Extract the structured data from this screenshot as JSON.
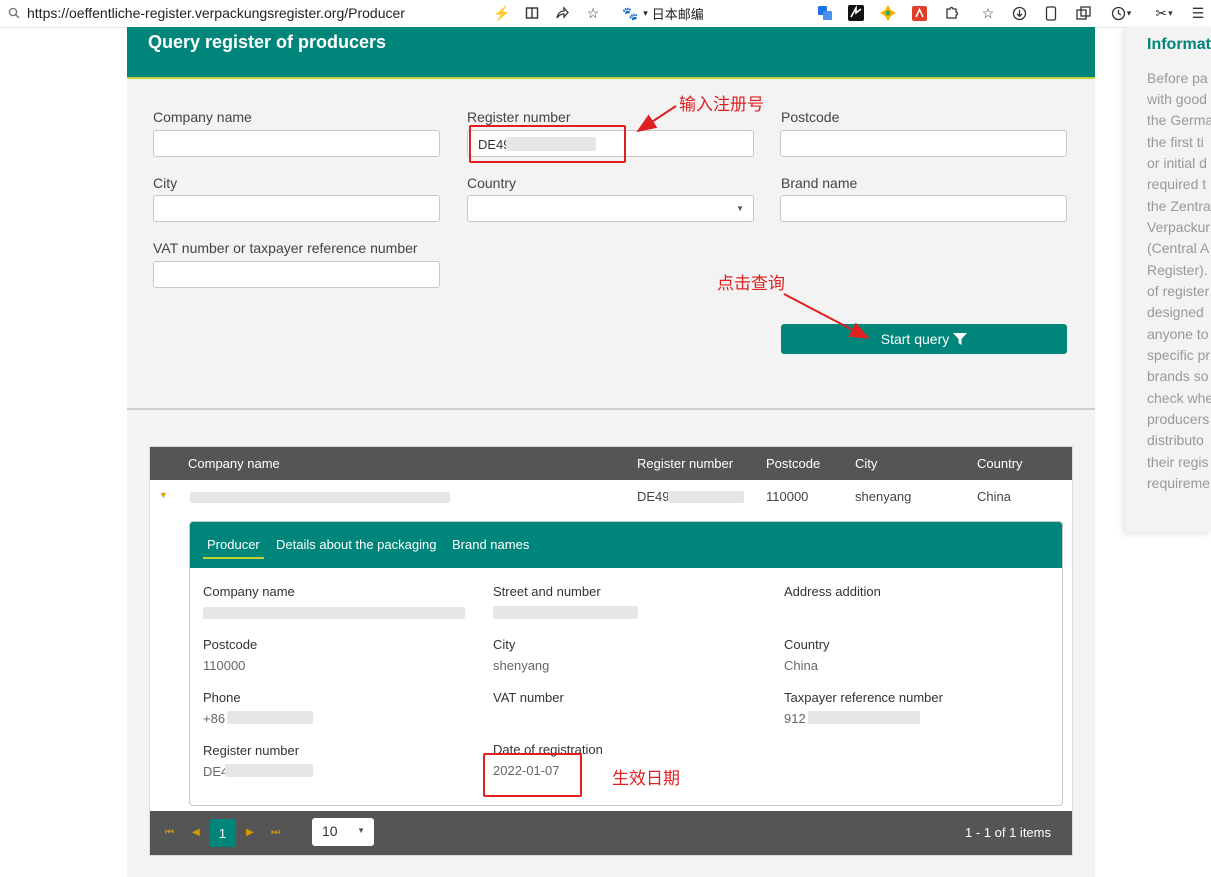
{
  "browser": {
    "url": "https://oeffentliche-register.verpackungsregister.org/Producer",
    "baidu_label": "日本邮编"
  },
  "form": {
    "title": "Query register of producers",
    "company_name_label": "Company name",
    "register_number_label": "Register number",
    "register_number_value": "DE49",
    "postcode_label": "Postcode",
    "city_label": "City",
    "country_label": "Country",
    "brand_name_label": "Brand name",
    "vat_label": "VAT number or taxpayer reference number",
    "start_query_label": "Start query"
  },
  "grid": {
    "columns": [
      "Company name",
      "Register number",
      "Postcode",
      "City",
      "Country"
    ],
    "row": {
      "register_number": "DE49",
      "postcode": "110000",
      "city": "shenyang",
      "country": "China"
    },
    "tabs": [
      "Producer",
      "Details about the packaging",
      "Brand names"
    ],
    "details": {
      "company_name_label": "Company name",
      "street_label": "Street and number",
      "address_addition_label": "Address addition",
      "postcode_label": "Postcode",
      "postcode_value": "110000",
      "city_label": "City",
      "city_value": "shenyang",
      "country_label": "Country",
      "country_value": "China",
      "phone_label": "Phone",
      "phone_value": "+86",
      "vat_label": "VAT number",
      "taxpayer_label": "Taxpayer reference number",
      "taxpayer_value": "912",
      "register_number_label": "Register number",
      "register_number_value": "DE4",
      "date_label": "Date of registration",
      "date_value": "2022-01-07"
    },
    "pager": {
      "current_page": "1",
      "page_size": "10",
      "info": "1 - 1 of 1 items"
    }
  },
  "sidebar": {
    "title": "Informat",
    "lines": [
      "Before pa",
      "with good",
      "the Germa",
      "the first ti",
      "or initial d",
      "required t",
      "the Zentra",
      "Verpackur",
      "(Central A",
      "Register).",
      "of register",
      "designed",
      "anyone to",
      "specific pr",
      "brands so",
      "check whe",
      "producers",
      "distributo",
      "their regis",
      "requireme"
    ]
  },
  "annotations": {
    "enter_register": "输入注册号",
    "click_query": "点击查询",
    "effective_date": "生效日期",
    "color": "#e02020"
  },
  "colors": {
    "brand_teal": "#00857a",
    "accent_yellow": "#c7cf34",
    "grid_header": "#555555"
  }
}
